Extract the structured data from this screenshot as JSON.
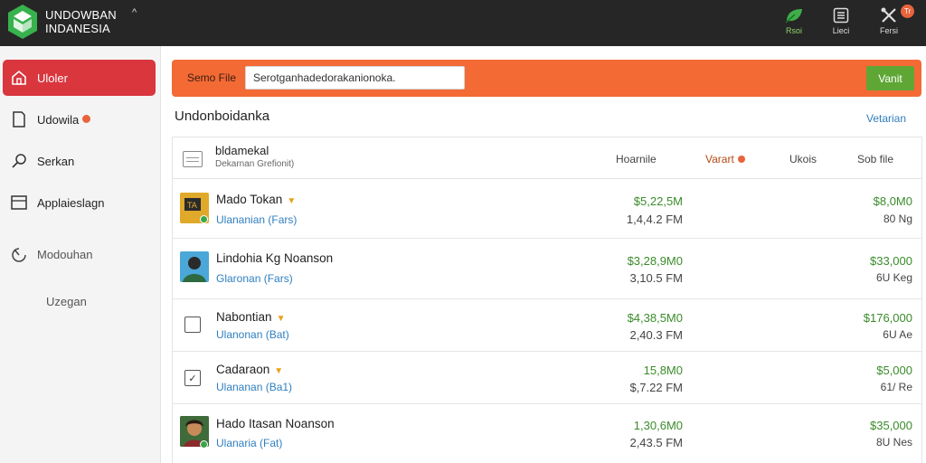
{
  "header": {
    "brand_line1": "UNDOWBAN",
    "brand_line2": "INDANESIA",
    "caret": "^",
    "actions": [
      {
        "label": "Rsoi",
        "icon": "leaf-icon"
      },
      {
        "label": "Lieci",
        "icon": "document-icon"
      },
      {
        "label": "Fersi",
        "icon": "tools-icon"
      }
    ],
    "notification_count": "Tr"
  },
  "sidebar": {
    "items": [
      {
        "label": "Uloler",
        "icon": "home-icon",
        "active": true
      },
      {
        "label": "Udowila",
        "icon": "page-icon",
        "badge": true
      },
      {
        "label": "Serkan",
        "icon": "search-icon"
      },
      {
        "label": "Applaieslagn",
        "icon": "list-icon"
      },
      {
        "label": "Modouhan",
        "icon": "chart-icon"
      },
      {
        "label": "Uzegan"
      }
    ]
  },
  "search": {
    "label": "Semo File",
    "value": "Serotganhadedorakanionoka.",
    "button": "Vanit"
  },
  "section": {
    "title": "Undonboidanka",
    "link": "Vetarian"
  },
  "table": {
    "header_main": "bldamekal",
    "header_sub": "Dekarnan Grefionit)",
    "columns": [
      "Hoarnile",
      "Varart",
      "Ukois",
      "Sob file"
    ],
    "rows": [
      {
        "name": "Mado Tokan",
        "star": true,
        "sub": "Ulananian (Fars)",
        "v1": "$5,22,5M",
        "v2": "1,4,4.2 FM",
        "w1": "$8,0M0",
        "w2": "80 Ng",
        "thumb": "book"
      },
      {
        "name": "Lindohia Kg Noanson",
        "star": false,
        "sub": "Glaronan (Fars)",
        "v1": "$3,28,9M0",
        "v2": "3,10.5 FM",
        "w1": "$33,000",
        "w2": "6U Keg",
        "thumb": "person"
      },
      {
        "name": "Nabontian",
        "star": true,
        "sub": "Ulanonan (Bat)",
        "v1": "$4,38,5M0",
        "v2": "2,40.3 FM",
        "w1": "$176,000",
        "w2": "6U Ae",
        "thumb": "box"
      },
      {
        "name": "Cadaraon",
        "star": true,
        "sub": "Ulananan (Ba1)",
        "v1": "15,8M0",
        "v2": "$,7.22 FM",
        "w1": "$5,000",
        "w2": "61/ Re",
        "thumb": "check"
      },
      {
        "name": "Hado Itasan Noanson",
        "star": false,
        "sub": "Ulanaria (Fat)",
        "v1": "1,30,6M0",
        "v2": "2,43.5 FM",
        "w1": "$35,000",
        "w2": "8U Nes",
        "thumb": "photo"
      }
    ]
  },
  "colors": {
    "topbar": "#262626",
    "sidebar_active": "#d9363e",
    "search_bar": "#f36a35",
    "search_button": "#5fa735",
    "positive_value": "#3a8b2a",
    "link": "#2f7fbf"
  }
}
